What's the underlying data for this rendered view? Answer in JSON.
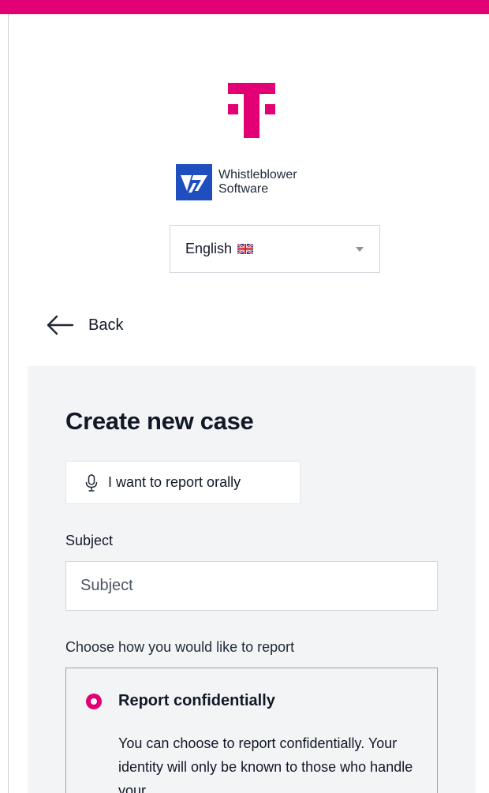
{
  "colors": {
    "brand_magenta": "#e20074",
    "product_blue": "#1f4fbf",
    "card_background": "#f3f4f5"
  },
  "brand": {
    "logo_icon": "telekom-t-icon"
  },
  "product": {
    "logo_icon": "whistleblower-software-icon",
    "name": "Whistleblower Software"
  },
  "language": {
    "selected": "English",
    "flag_icon": "uk-flag-icon",
    "caret_icon": "chevron-down-icon"
  },
  "nav": {
    "back_label": "Back",
    "back_icon": "arrow-left-icon"
  },
  "form": {
    "title": "Create new case",
    "oral_report_label": "I want to report orally",
    "oral_report_icon": "microphone-icon",
    "subject_label": "Subject",
    "subject_placeholder": "Subject",
    "subject_value": "",
    "method_label": "Choose how you would like to report",
    "options": [
      {
        "title": "Report confidentially",
        "selected": true,
        "description": "You can choose to report confidentially. Your identity will only be known to those who handle your"
      }
    ]
  }
}
